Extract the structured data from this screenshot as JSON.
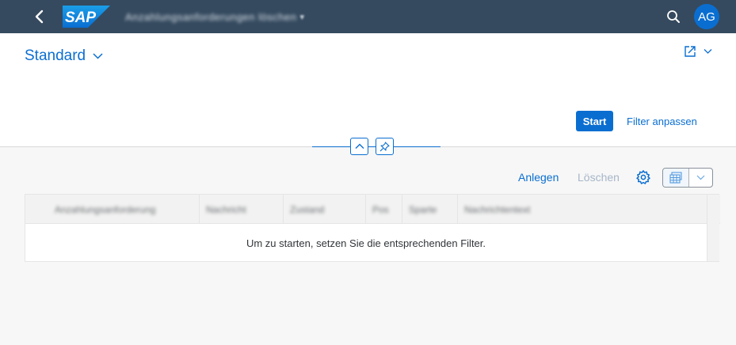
{
  "shell": {
    "logo_text": "SAP",
    "app_title": "Anzahlungsanforderungen löschen",
    "user_initials": "AG"
  },
  "header": {
    "variant_label": "Standard",
    "start_label": "Start",
    "adapt_filters_label": "Filter anpassen"
  },
  "toolbar": {
    "create_label": "Anlegen",
    "delete_label": "Löschen"
  },
  "table": {
    "columns": [
      "Anzahlungsanforderung",
      "Nachricht",
      "Zustand",
      "Pos",
      "Sparte",
      "Nachrichtentext"
    ],
    "empty_text": "Um zu starten, setzen Sie die entsprechenden Filter."
  },
  "colors": {
    "shell": "#354a5f",
    "accent": "#0a6ed1",
    "background": "#f7f7f7"
  },
  "icons": [
    "back-icon",
    "search-icon",
    "share-icon",
    "collapse-icon",
    "pin-icon",
    "settings-icon",
    "table-view-icon",
    "chevron-down-icon"
  ]
}
